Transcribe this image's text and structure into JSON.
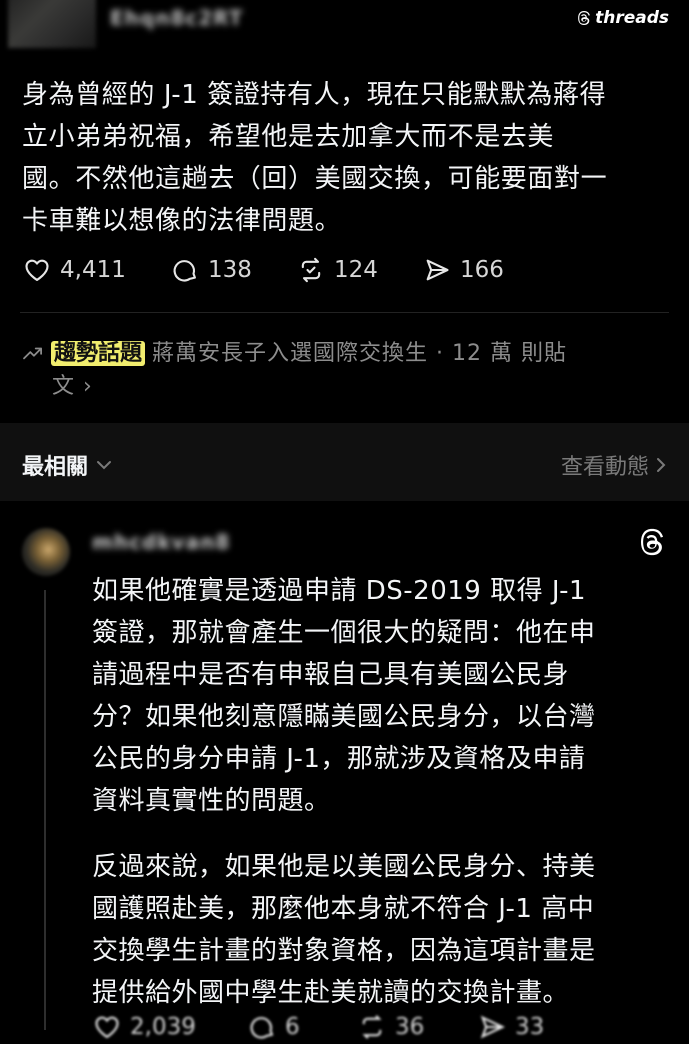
{
  "top_post": {
    "username": "Ehqn8c2RT",
    "brand": "threads",
    "text_lines": [
      "身為曾經的 J-1 簽證持有人，現在只能默默為蔣得",
      "立小弟弟祝福，希望他是去加拿大而不是去美",
      "國。不然他這趟去（回）美國交換，可能要面對一",
      "卡車難以想像的法律問題。"
    ],
    "likes": "4,411",
    "replies": "138",
    "reposts": "124",
    "shares": "166"
  },
  "trending": {
    "badge": "趨勢話題",
    "line1": "蔣萬安長子入選國際交換生 · 12 萬 則貼",
    "line2": "文 ›"
  },
  "sort_bar": {
    "label": "最相關",
    "activity": "查看動態"
  },
  "reply": {
    "username": "mhcdkvan8",
    "para1": [
      "如果他確實是透過申請 DS-2019 取得 J-1",
      "簽證，那就會產生一個很大的疑問：他在申",
      "請過程中是否有申報自己具有美國公民身",
      "分？如果他刻意隱瞞美國公民身分，以台灣",
      "公民的身分申請 J-1，那就涉及資格及申請",
      "資料真實性的問題。"
    ],
    "para2": [
      "反過來說，如果他是以美國公民身分、持美",
      "國護照赴美，那麼他本身就不符合 J-1 高中",
      "交換學生計畫的對象資格，因為這項計畫是",
      "提供給外國中學生赴美就讀的交換計畫。"
    ],
    "likes": "2,039",
    "replies": "6",
    "reposts": "36",
    "shares": "33"
  },
  "colors": {
    "background": "#000000",
    "text": "#f3f5f7",
    "muted": "#8a8a8a",
    "trend_highlight": "#f1ed6e"
  }
}
